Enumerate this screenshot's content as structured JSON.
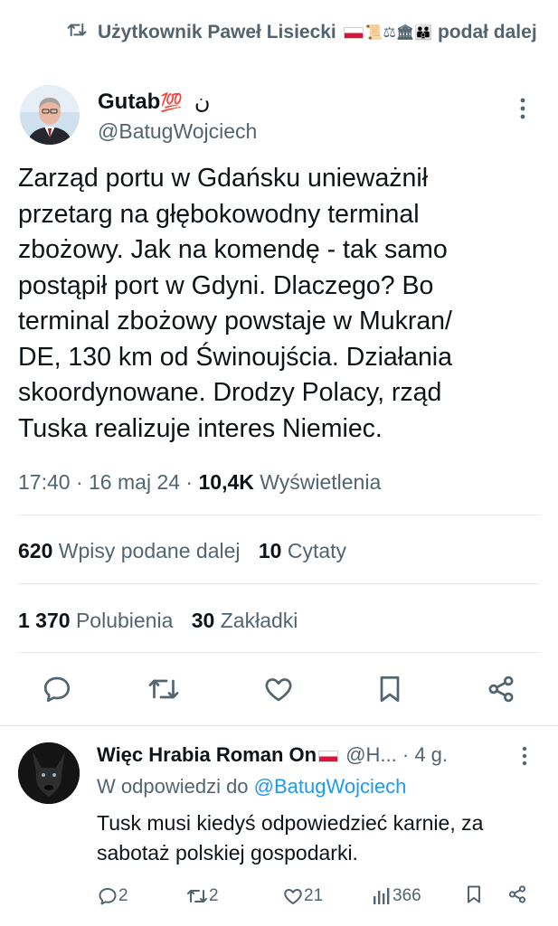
{
  "retweet_context": {
    "prefix": "Użytkownik Paweł Lisiecki",
    "suffix": "podał dalej",
    "emoji_names": [
      "poland-flag",
      "scroll",
      "balance-scale",
      "classical-building",
      "family"
    ]
  },
  "author": {
    "display_name": "Gutab",
    "name_emoji": "💯",
    "name_suffix": "ن",
    "handle": "@BatugWojciech"
  },
  "tweet": {
    "text": "Zarząd portu w Gdańsku unieważnił\nprzetarg na głębokowodny terminal\nzbożowy. Jak na komendę - tak samo\npostąpił port w Gdyni. Dlaczego? Bo\nterminal zbożowy powstaje w Mukran/\nDE, 130 km od Świnoujścia. Działania\nskoordynowane. Drodzy Polacy, rząd\nTuska realizuje interes Niemiec.",
    "time": "17:40",
    "date": "16 maj 24",
    "views_count": "10,4K",
    "views_label": "Wyświetlenia"
  },
  "stats": {
    "reposts_count": "620",
    "reposts_label": "Wpisy podane dalej",
    "quotes_count": "10",
    "quotes_label": "Cytaty",
    "likes_count": "1 370",
    "likes_label": "Polubienia",
    "bookmarks_count": "30",
    "bookmarks_label": "Zakładki"
  },
  "actions": [
    "reply-icon",
    "retweet-icon",
    "heart-icon",
    "bookmark-icon",
    "share-icon"
  ],
  "reply": {
    "name": "Więc Hrabia Roman On",
    "handle": "@H...",
    "age": "· 4 g.",
    "reply_to_label": "W odpowiedzi do",
    "reply_to_handle": "@BatugWojciech",
    "text": "Tusk musi kiedyś odpowiedzieć karnie, za\nsabotaż polskiej gospodarki.",
    "replies": "2",
    "reposts": "2",
    "likes": "21",
    "views": "366"
  },
  "colors": {
    "text": "#0f1419",
    "secondary": "#536471",
    "link": "#1d9bf0",
    "divider": "#e6ecf0"
  }
}
